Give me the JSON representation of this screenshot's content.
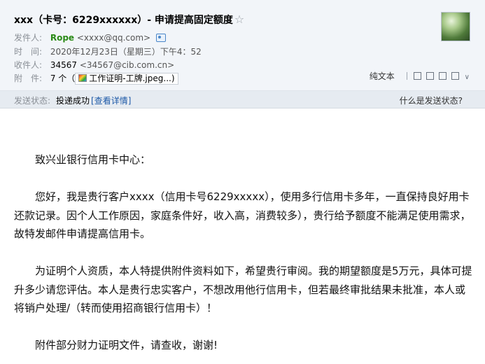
{
  "header": {
    "subject": "xxx（卡号：6229xxxxxx）- 申请提高固定额度",
    "star": "☆",
    "sender_label": "发件人:",
    "sender_name": "Rope",
    "sender_addr": "<xxxx@qq.com>",
    "time_label": "时　间:",
    "time_value": "2020年12月23日（星期三）下午4：52",
    "recipient_label": "收件人:",
    "recipient_name": "34567",
    "recipient_addr": "<34567@cib.com.cn>",
    "attach_label": "附　件:",
    "attach_count": "7 个（",
    "attach_name": "工作证明-工牌.jpeg...)"
  },
  "toolbar": {
    "plain_text": "纯文本"
  },
  "status": {
    "label": "发送状态:",
    "value": "投递成功",
    "detail": "[查看详情]",
    "help": "什么是发送状态?"
  },
  "body": {
    "greeting": "致兴业银行信用卡中心：",
    "p1": "您好，我是贵行客户xxxx（信用卡号6229xxxxx），使用多行信用卡多年，一直保持良好用卡还款记录。因个人工作原因，家庭条件好，收入高，消费较多），贵行给予额度不能满足使用需求，故特发邮件申请提高信用卡。",
    "p2": "为证明个人资质，本人特提供附件资料如下，希望贵行审阅。我的期望额度是5万元，具体可提升多少请您评估。本人是贵行忠实客户，不想改用他行信用卡，但若最终审批结果未批准，本人或将销户处理/（转而使用招商银行信用卡）！",
    "p3": "附件部分财力证明文件，请查收，谢谢!"
  }
}
